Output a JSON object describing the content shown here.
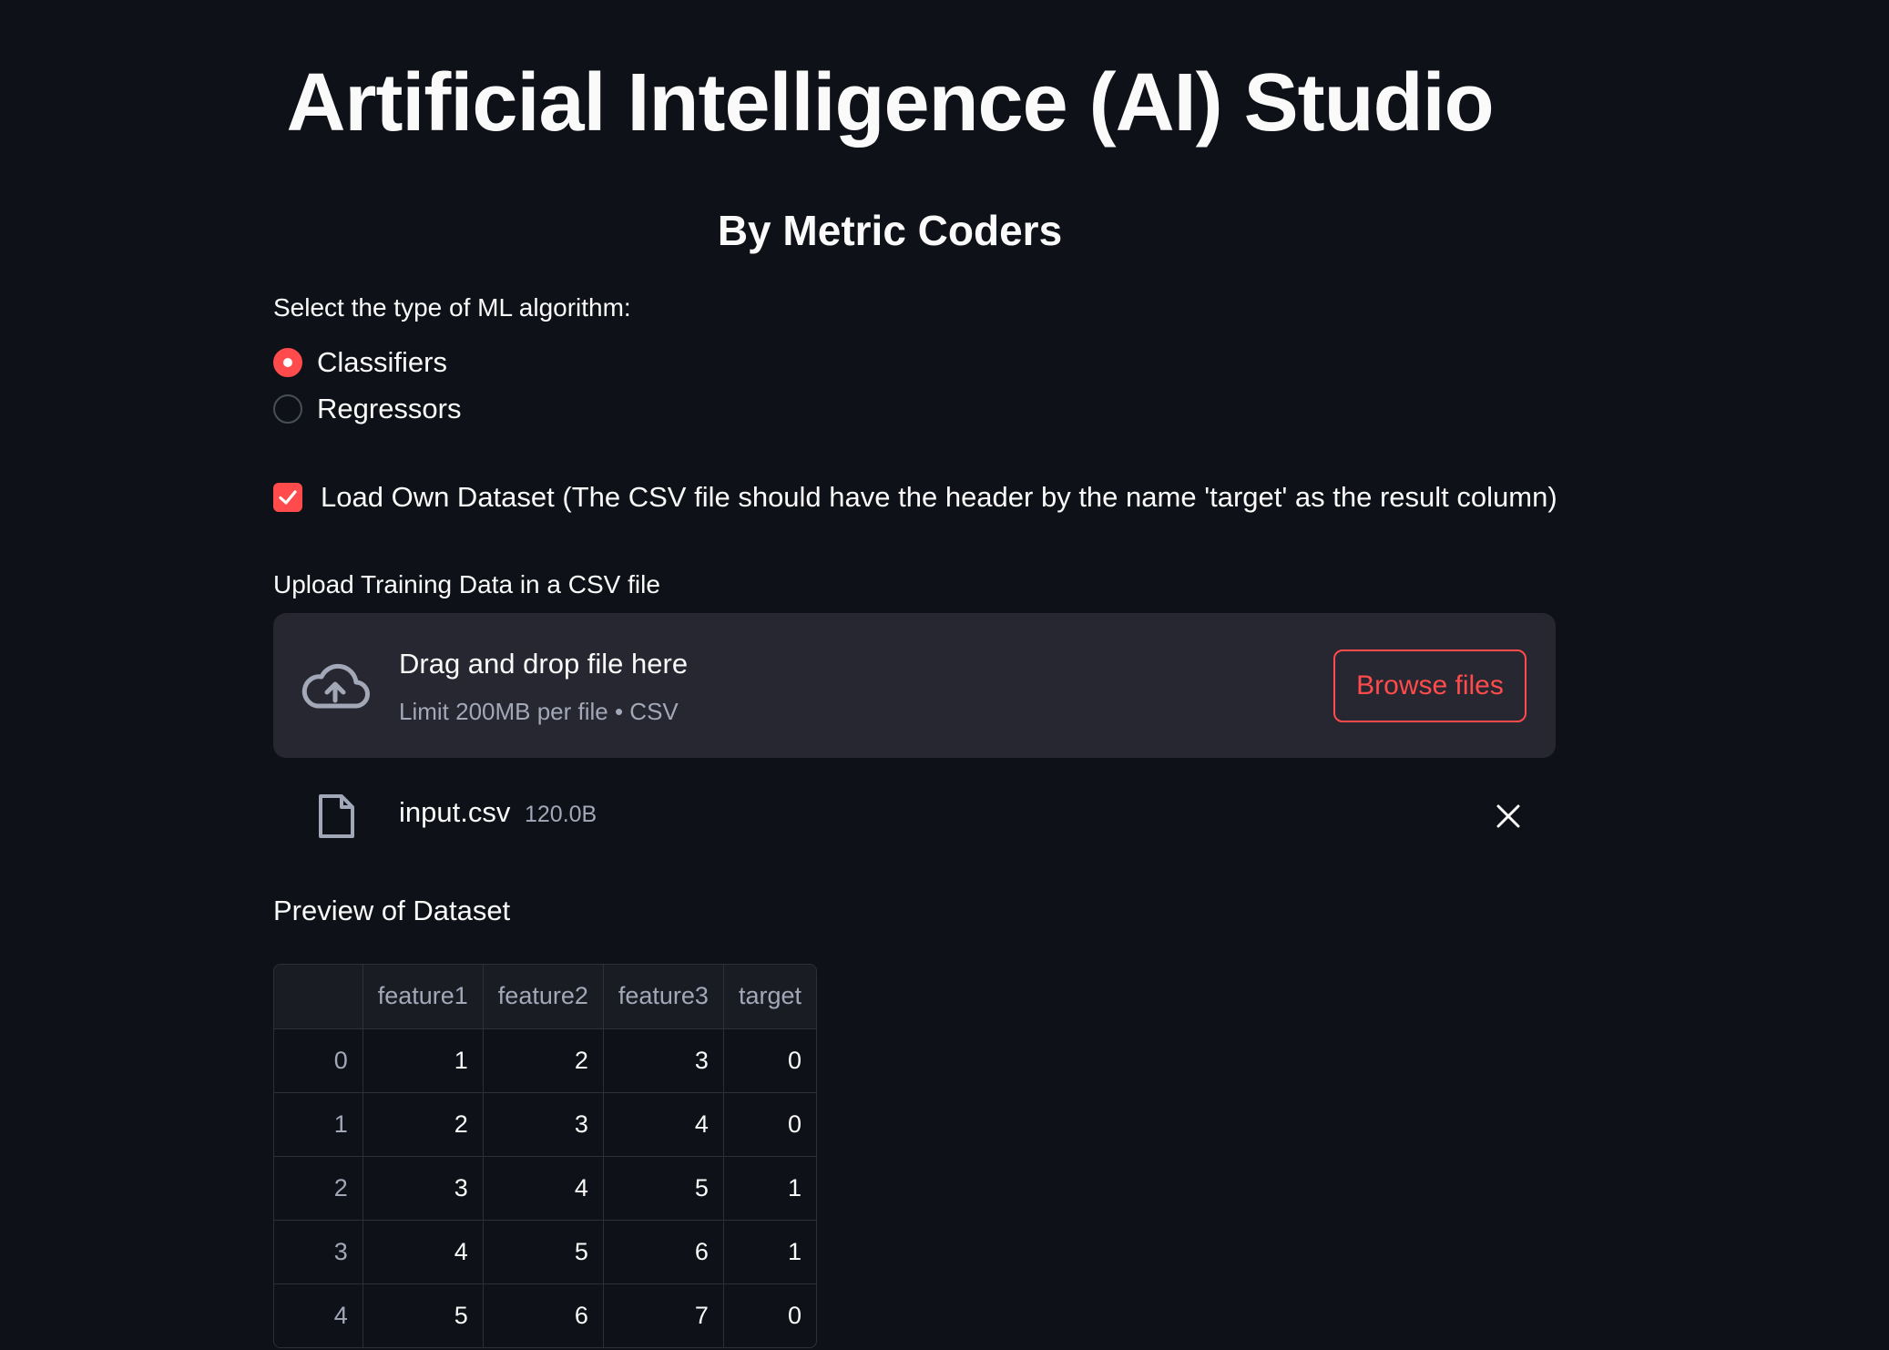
{
  "header": {
    "title": "Artificial Intelligence (AI) Studio",
    "subtitle": "By Metric Coders"
  },
  "algorithm": {
    "label": "Select the type of ML algorithm:",
    "options": [
      "Classifiers",
      "Regressors"
    ],
    "selected": "Classifiers"
  },
  "dataset_checkbox": {
    "label": "Load Own Dataset (The CSV file should have the header by the name 'target' as the result column)",
    "checked": true
  },
  "uploader": {
    "label": "Upload Training Data in a CSV file",
    "drop_title": "Drag and drop file here",
    "drop_limit": "Limit 200MB per file • CSV",
    "browse_label": "Browse files"
  },
  "uploaded_file": {
    "name": "input.csv",
    "size": "120.0B"
  },
  "preview": {
    "title": "Preview of Dataset",
    "columns": [
      "",
      "feature1",
      "feature2",
      "feature3",
      "target"
    ],
    "rows": [
      [
        "0",
        "1",
        "2",
        "3",
        "0"
      ],
      [
        "1",
        "2",
        "3",
        "4",
        "0"
      ],
      [
        "2",
        "3",
        "4",
        "5",
        "1"
      ],
      [
        "3",
        "4",
        "5",
        "6",
        "1"
      ],
      [
        "4",
        "5",
        "6",
        "7",
        "0"
      ]
    ]
  },
  "colors": {
    "background": "#0e1117",
    "accent": "#ff4b4b",
    "panel": "#262730"
  }
}
